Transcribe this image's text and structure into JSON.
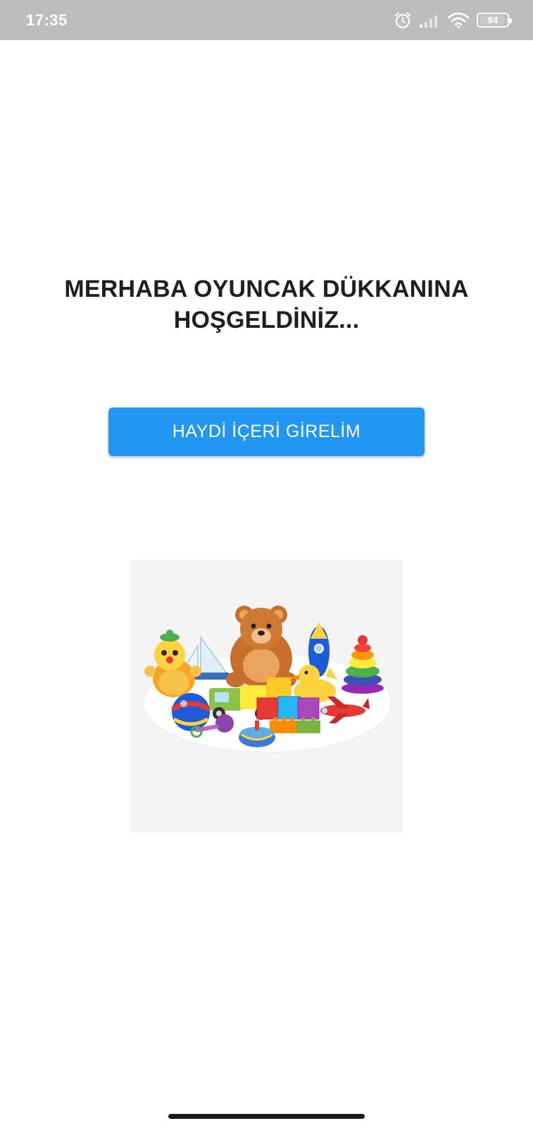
{
  "status_bar": {
    "time": "17:35",
    "battery_percent": "94",
    "icons": [
      "alarm-icon",
      "signal-icon",
      "wifi-icon",
      "battery-icon"
    ]
  },
  "welcome": {
    "title": "MERHABA OYUNCAK DÜKKANINA HOŞGELDİNİZ..."
  },
  "enter_button": {
    "label": "HAYDİ İÇERİ GİRELİM"
  },
  "colors": {
    "status_bar": "#bdbdbd",
    "button": "#2196f3",
    "title_text": "#1f1f1f",
    "background": "#ffffff"
  },
  "illustration": {
    "icon": "toys-illustration"
  }
}
